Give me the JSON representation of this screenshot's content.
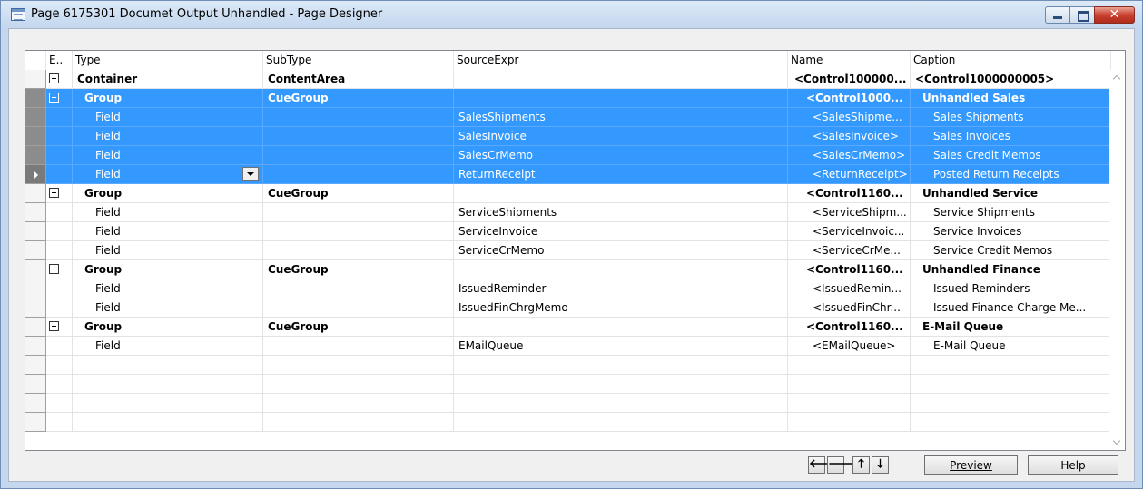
{
  "window": {
    "title": "Page 6175301 Documet Output Unhandled - Page Designer",
    "close_glyph": "✕"
  },
  "grid": {
    "columns": [
      "E..",
      "Type",
      "SubType",
      "SourceExpr",
      "Name",
      "Caption"
    ],
    "rows": [
      {
        "type": "Container",
        "subtype": "ContentArea",
        "source": "",
        "name": "<Control100000...",
        "caption": "<Control1000000005>",
        "level": 0,
        "bold": true,
        "expander": true,
        "selected": false
      },
      {
        "type": "Group",
        "subtype": "CueGroup",
        "source": "",
        "name": "<Control1000...",
        "caption": "Unhandled Sales",
        "level": 1,
        "bold": true,
        "expander": true,
        "selected": true
      },
      {
        "type": "Field",
        "subtype": "",
        "source": "SalesShipments",
        "name": "<SalesShipme...",
        "caption": "Sales Shipments",
        "level": 2,
        "bold": false,
        "expander": false,
        "selected": true
      },
      {
        "type": "Field",
        "subtype": "",
        "source": "SalesInvoice",
        "name": "<SalesInvoice>",
        "caption": "Sales Invoices",
        "level": 2,
        "bold": false,
        "expander": false,
        "selected": true
      },
      {
        "type": "Field",
        "subtype": "",
        "source": "SalesCrMemo",
        "name": "<SalesCrMemo>",
        "caption": "Sales Credit Memos",
        "level": 2,
        "bold": false,
        "expander": false,
        "selected": true
      },
      {
        "type": "Field",
        "subtype": "",
        "source": "ReturnReceipt",
        "name": "<ReturnReceipt>",
        "caption": "Posted Return Receipts",
        "level": 2,
        "bold": false,
        "expander": false,
        "selected": true,
        "current": true
      },
      {
        "type": "Group",
        "subtype": "CueGroup",
        "source": "",
        "name": "<Control1160...",
        "caption": "Unhandled Service",
        "level": 1,
        "bold": true,
        "expander": true,
        "selected": false
      },
      {
        "type": "Field",
        "subtype": "",
        "source": "ServiceShipments",
        "name": "<ServiceShipm...",
        "caption": "Service Shipments",
        "level": 2,
        "bold": false,
        "expander": false,
        "selected": false
      },
      {
        "type": "Field",
        "subtype": "",
        "source": "ServiceInvoice",
        "name": "<ServiceInvoic...",
        "caption": "Service Invoices",
        "level": 2,
        "bold": false,
        "expander": false,
        "selected": false
      },
      {
        "type": "Field",
        "subtype": "",
        "source": "ServiceCrMemo",
        "name": "<ServiceCrMe...",
        "caption": "Service Credit Memos",
        "level": 2,
        "bold": false,
        "expander": false,
        "selected": false
      },
      {
        "type": "Group",
        "subtype": "CueGroup",
        "source": "",
        "name": "<Control1160...",
        "caption": "Unhandled Finance",
        "level": 1,
        "bold": true,
        "expander": true,
        "selected": false
      },
      {
        "type": "Field",
        "subtype": "",
        "source": "IssuedReminder",
        "name": "<IssuedRemin...",
        "caption": "Issued Reminders",
        "level": 2,
        "bold": false,
        "expander": false,
        "selected": false
      },
      {
        "type": "Field",
        "subtype": "",
        "source": "IssuedFinChrgMemo",
        "name": "<IssuedFinChr...",
        "caption": "Issued Finance Charge Me...",
        "level": 2,
        "bold": false,
        "expander": false,
        "selected": false
      },
      {
        "type": "Group",
        "subtype": "CueGroup",
        "source": "",
        "name": "<Control1160...",
        "caption": "E-Mail Queue",
        "level": 1,
        "bold": true,
        "expander": true,
        "selected": false
      },
      {
        "type": "Field",
        "subtype": "",
        "source": "EMailQueue",
        "name": "<EMailQueue>",
        "caption": "E-Mail Queue",
        "level": 2,
        "bold": false,
        "expander": false,
        "selected": false
      },
      {
        "type": "",
        "subtype": "",
        "source": "",
        "name": "",
        "caption": "",
        "level": 0,
        "bold": false,
        "expander": false,
        "selected": false
      },
      {
        "type": "",
        "subtype": "",
        "source": "",
        "name": "",
        "caption": "",
        "level": 0,
        "bold": false,
        "expander": false,
        "selected": false
      },
      {
        "type": "",
        "subtype": "",
        "source": "",
        "name": "",
        "caption": "",
        "level": 0,
        "bold": false,
        "expander": false,
        "selected": false
      },
      {
        "type": "",
        "subtype": "",
        "source": "",
        "name": "",
        "caption": "",
        "level": 0,
        "bold": false,
        "expander": false,
        "selected": false
      }
    ]
  },
  "toolbar": {
    "left_arrow": "🡐",
    "right_arrow": "🡒",
    "up_arrow": "🡑",
    "down_arrow": "🡓",
    "preview_label": "Preview",
    "help_label": "Help"
  },
  "colors": {
    "selection": "#3399ff",
    "title_gradient_top": "#dce9f7",
    "close_button": "#c9402f"
  }
}
